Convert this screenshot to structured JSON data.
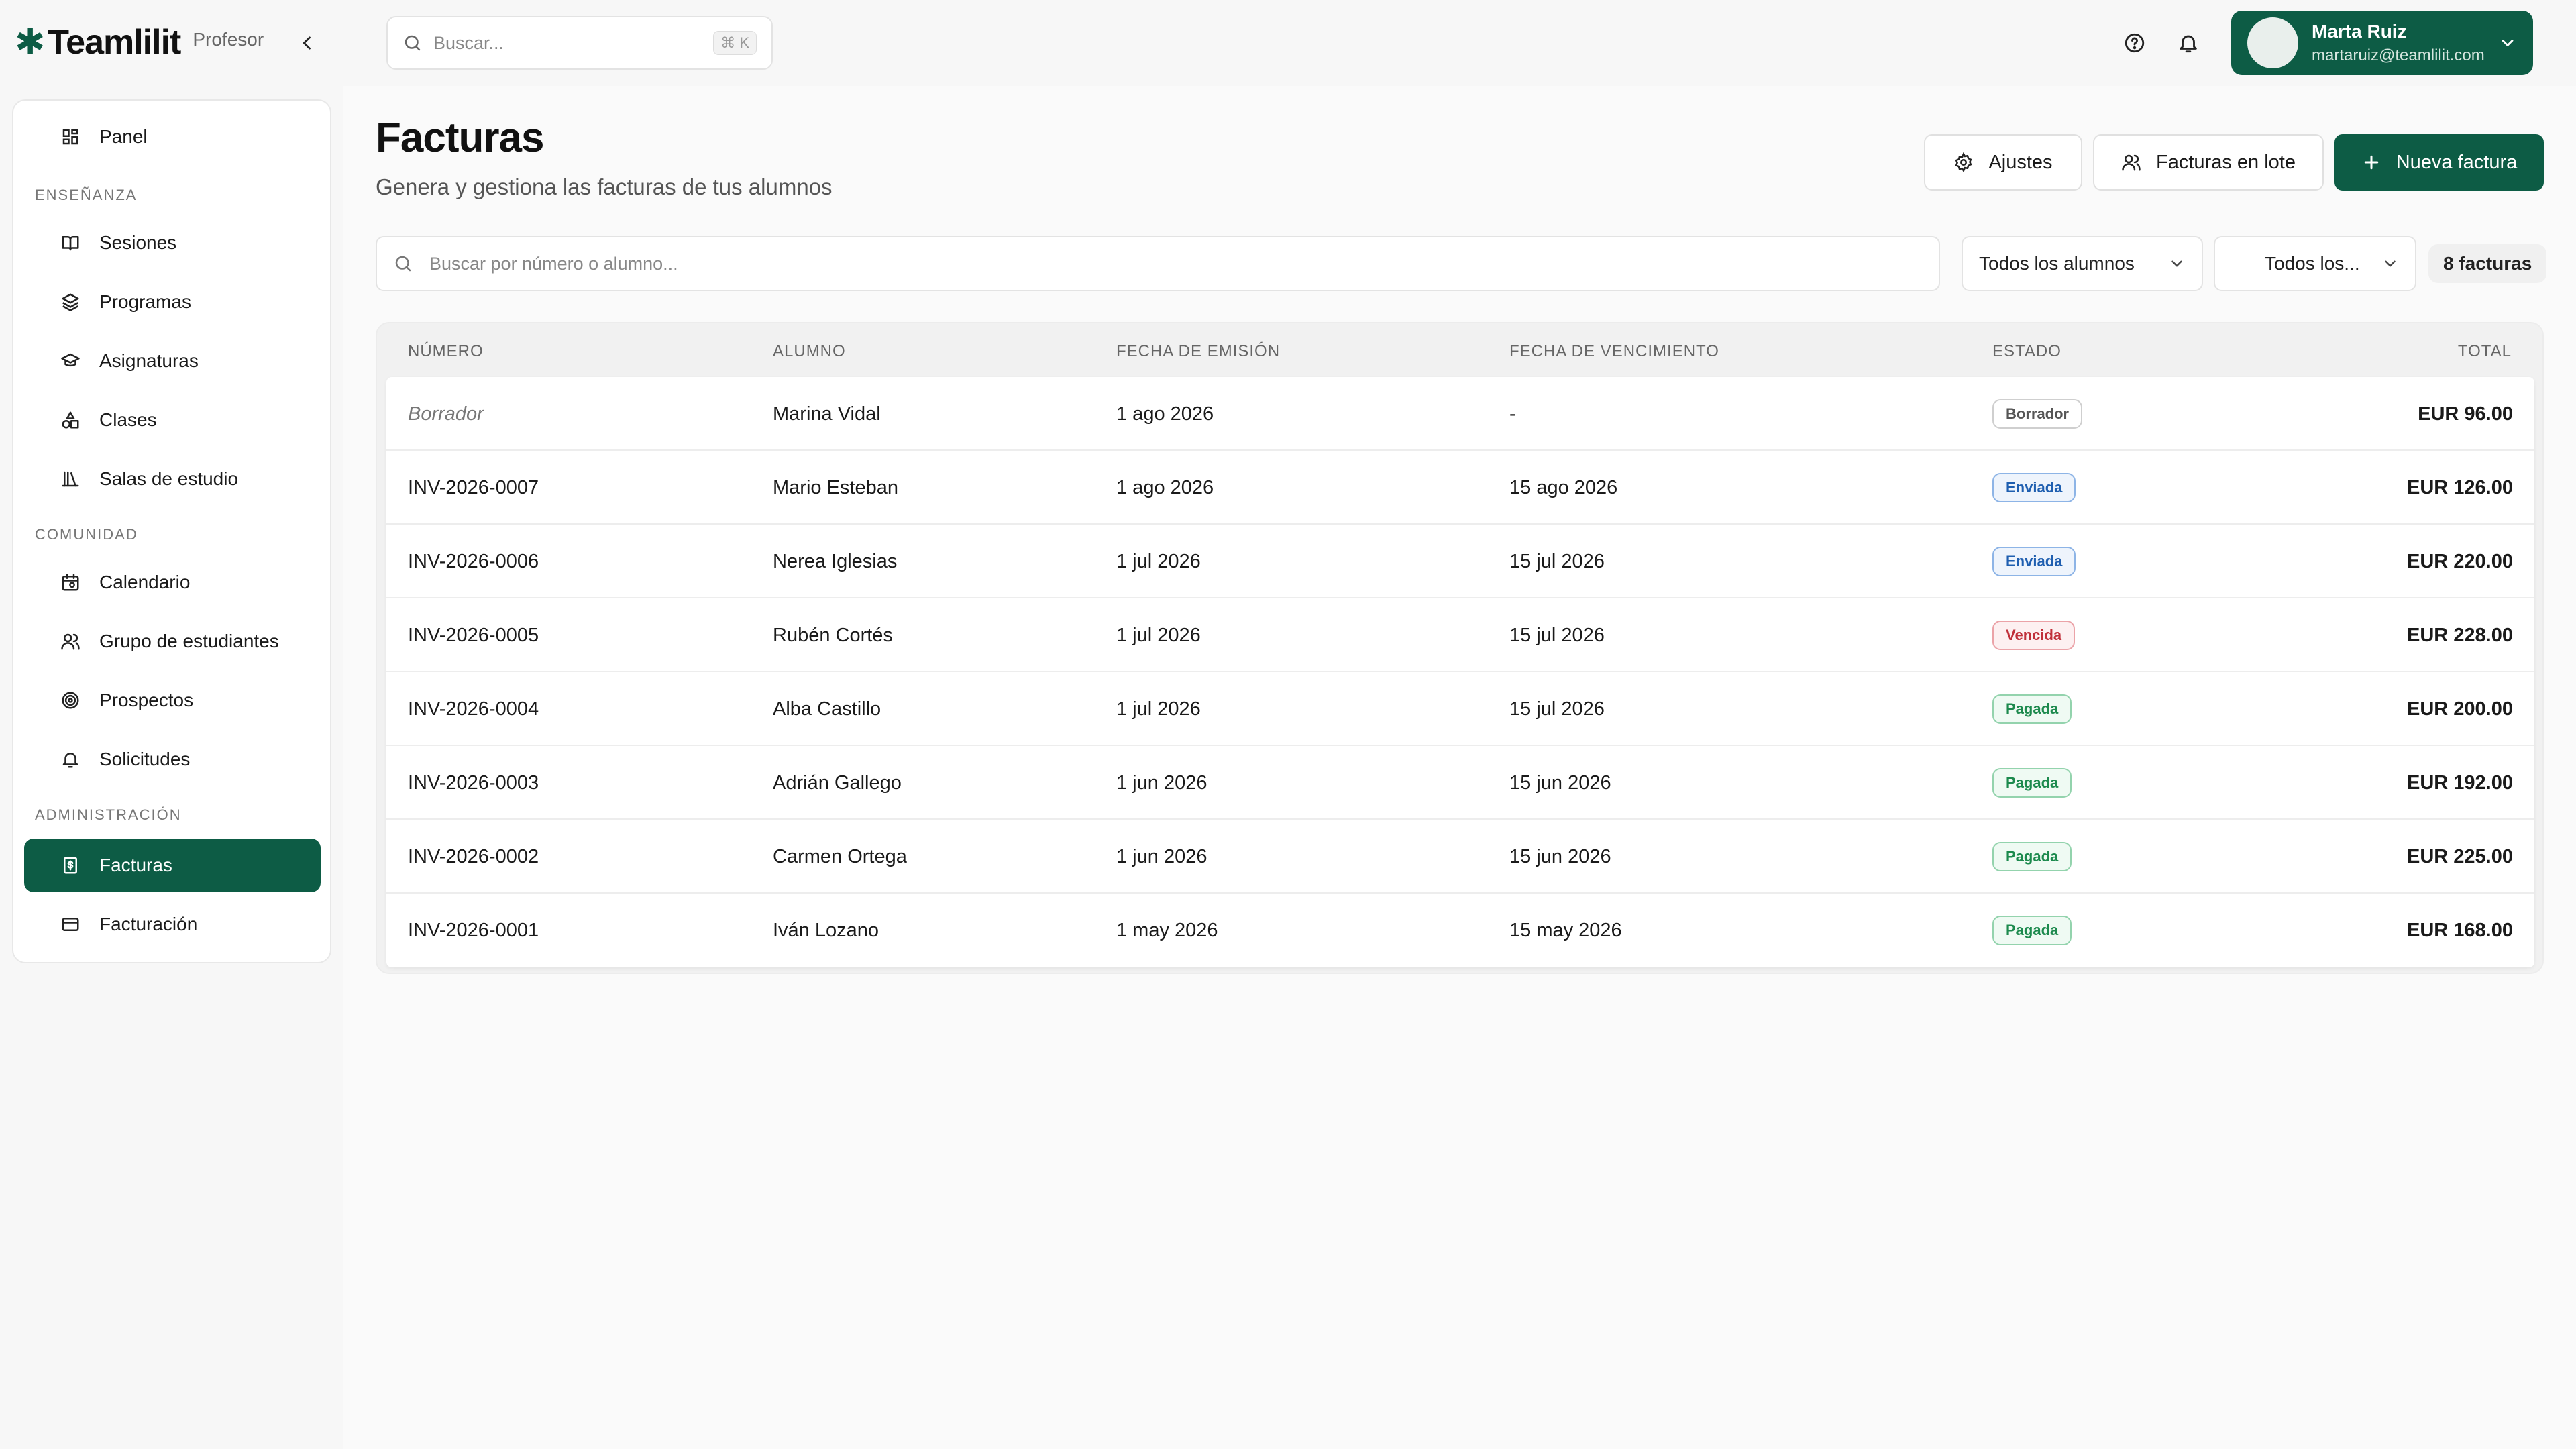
{
  "brand": {
    "name": "Teamlilit",
    "mark": "✱",
    "role": "Profesor"
  },
  "search": {
    "placeholder": "Buscar...",
    "shortcut": "⌘ K"
  },
  "user": {
    "name": "Marta Ruiz",
    "email": "martaruiz@teamlilit.com"
  },
  "sidebar": {
    "panel": "Panel",
    "sections": {
      "teaching": "ENSEÑANZA",
      "community": "COMUNIDAD",
      "admin": "ADMINISTRACIÓN"
    },
    "items": {
      "sessions": "Sesiones",
      "programs": "Programas",
      "subjects": "Asignaturas",
      "classes": "Clases",
      "study_rooms": "Salas de estudio",
      "calendar": "Calendario",
      "student_group": "Grupo de estudiantes",
      "prospects": "Prospectos",
      "requests": "Solicitudes",
      "invoices": "Facturas",
      "billing": "Facturación"
    }
  },
  "page": {
    "title": "Facturas",
    "subtitle": "Genera y gestiona las facturas de tus alumnos",
    "buttons": {
      "settings": "Ajustes",
      "batch": "Facturas en lote",
      "new": "Nueva factura"
    }
  },
  "filters": {
    "search_placeholder": "Buscar por número o alumno...",
    "students": "Todos los alumnos",
    "status": "Todos los...",
    "count": "8 facturas"
  },
  "table": {
    "headers": {
      "number": "NÚMERO",
      "student": "ALUMNO",
      "issue_date": "FECHA DE EMISIÓN",
      "due_date": "FECHA DE VENCIMIENTO",
      "status": "ESTADO",
      "total": "TOTAL"
    },
    "rows": [
      {
        "number": "Borrador",
        "student": "Marina Vidal",
        "issue": "1 ago 2026",
        "due": "-",
        "status": "Borrador",
        "total": "EUR 96.00"
      },
      {
        "number": "INV-2026-0007",
        "student": "Mario Esteban",
        "issue": "1 ago 2026",
        "due": "15 ago 2026",
        "status": "Enviada",
        "total": "EUR 126.00"
      },
      {
        "number": "INV-2026-0006",
        "student": "Nerea Iglesias",
        "issue": "1 jul 2026",
        "due": "15 jul 2026",
        "status": "Enviada",
        "total": "EUR 220.00"
      },
      {
        "number": "INV-2026-0005",
        "student": "Rubén Cortés",
        "issue": "1 jul 2026",
        "due": "15 jul 2026",
        "status": "Vencida",
        "total": "EUR 228.00"
      },
      {
        "number": "INV-2026-0004",
        "student": "Alba Castillo",
        "issue": "1 jul 2026",
        "due": "15 jul 2026",
        "status": "Pagada",
        "total": "EUR 200.00"
      },
      {
        "number": "INV-2026-0003",
        "student": "Adrián Gallego",
        "issue": "1 jun 2026",
        "due": "15 jun 2026",
        "status": "Pagada",
        "total": "EUR 192.00"
      },
      {
        "number": "INV-2026-0002",
        "student": "Carmen Ortega",
        "issue": "1 jun 2026",
        "due": "15 jun 2026",
        "status": "Pagada",
        "total": "EUR 225.00"
      },
      {
        "number": "INV-2026-0001",
        "student": "Iván Lozano",
        "issue": "1 may 2026",
        "due": "15 may 2026",
        "status": "Pagada",
        "total": "EUR 168.00"
      }
    ]
  },
  "status_colors": {
    "Borrador": {
      "fg": "#555555",
      "border": "#cfcfcf",
      "bg": "#ffffff"
    },
    "Enviada": {
      "fg": "#1f5fb0",
      "border": "#8db4e6",
      "bg": "#eef4fc"
    },
    "Vencida": {
      "fg": "#c0303a",
      "border": "#eba3a8",
      "bg": "#fdf0f1"
    },
    "Pagada": {
      "fg": "#1d8a4e",
      "border": "#93d3ad",
      "bg": "#effaf3"
    }
  },
  "colors": {
    "accent": "#0d5c45"
  }
}
